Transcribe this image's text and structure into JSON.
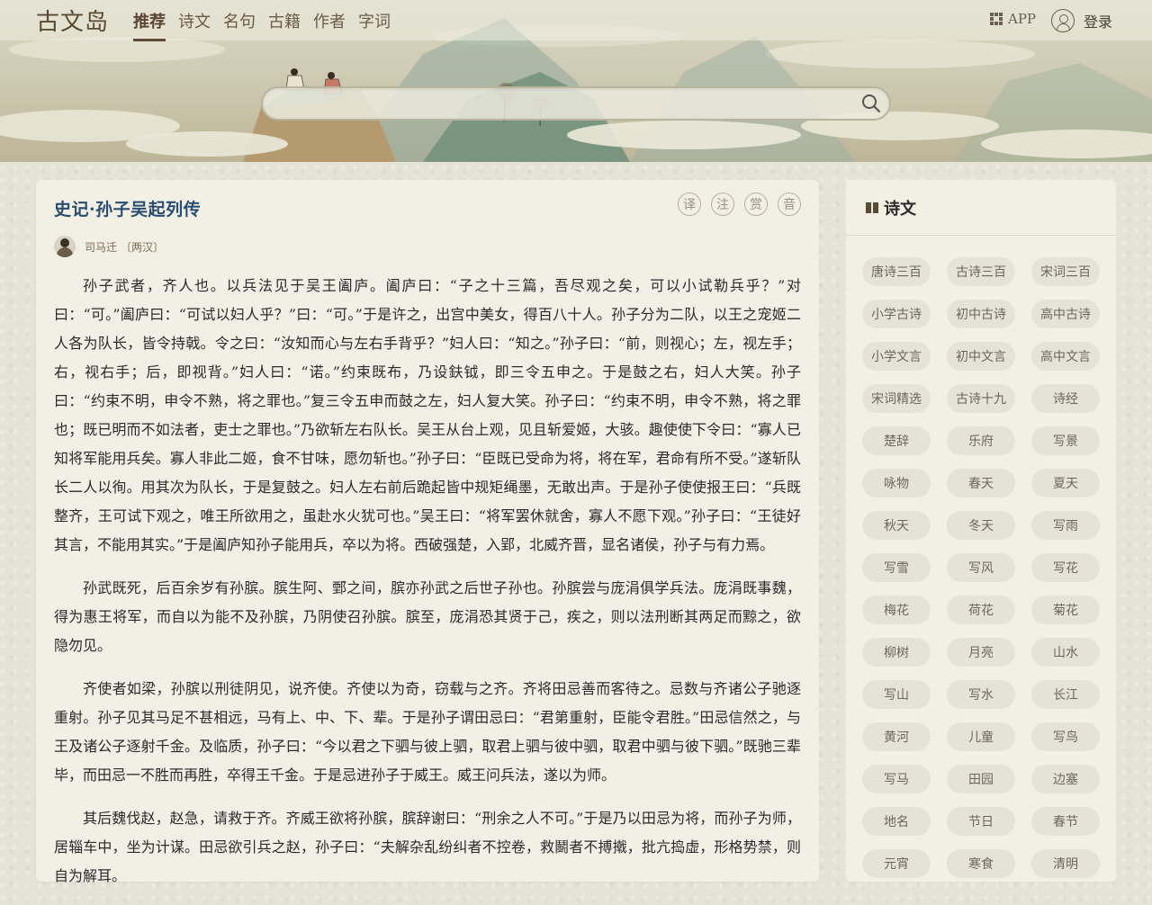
{
  "header": {
    "logo": "古文岛",
    "nav": [
      "推荐",
      "诗文",
      "名句",
      "古籍",
      "作者",
      "字词"
    ],
    "app_label": "APP",
    "login_label": "登录",
    "search_placeholder": ""
  },
  "article": {
    "title": "史记·孙子吴起列传",
    "tools": [
      "译",
      "注",
      "赏",
      "音"
    ],
    "author": "司马迁",
    "dynasty": "〔两汉〕",
    "paragraphs": [
      "孙子武者，齐人也。以兵法见于吴王阖庐。阖庐曰：“子之十三篇，吾尽观之矣，可以小试勒兵乎？”对曰：“可。”阖庐曰：“可试以妇人乎？”曰：“可。”于是许之，出宫中美女，得百八十人。孙子分为二队，以王之宠姬二人各为队长，皆令持戟。令之曰：“汝知而心与左右手背乎？”妇人曰：“知之。”孙子曰：“前，则视心；左，视左手；右，视右手；后，即视背。”妇人曰：“诺。”约束既布，乃设鈇钺，即三令五申之。于是鼓之右，妇人大笑。孙子曰：“约束不明，申令不熟，将之罪也。”复三令五申而鼓之左，妇人复大笑。孙子曰：“约束不明，申令不熟，将之罪也；既已明而不如法者，吏士之罪也。”乃欲斩左右队长。吴王从台上观，见且斩爱姬，大骇。趣使使下令曰：“寡人已知将军能用兵矣。寡人非此二姬，食不甘味，愿勿斩也。”孙子曰：“臣既已受命为将，将在军，君命有所不受。”遂斩队长二人以徇。用其次为队长，于是复鼓之。妇人左右前后跪起皆中规矩绳墨，无敢出声。于是孙子使使报王曰：“兵既整齐，王可试下观之，唯王所欲用之，虽赴水火犹可也。”吴王曰：“将军罢休就舍，寡人不愿下观。”孙子曰：“王徒好其言，不能用其实。”于是阖庐知孙子能用兵，卒以为将。西破强楚，入郢，北威齐晋，显名诸侯，孙子与有力焉。",
      "孙武既死，后百余岁有孙膑。膑生阿、鄄之间，膑亦孙武之后世子孙也。孙膑尝与庞涓俱学兵法。庞涓既事魏，得为惠王将军，而自以为能不及孙膑，乃阴使召孙膑。膑至，庞涓恐其贤于己，疾之，则以法刑断其两足而黥之，欲隐勿见。",
      "齐使者如梁，孙膑以刑徒阴见，说齐使。齐使以为奇，窃载与之齐。齐将田忌善而客待之。忌数与齐诸公子驰逐重射。孙子见其马足不甚相远，马有上、中、下、辈。于是孙子谓田忌曰：“君第重射，臣能令君胜。”田忌信然之，与王及诸公子逐射千金。及临质，孙子曰：“今以君之下驷与彼上驷，取君上驷与彼中驷，取君中驷与彼下驷。”既驰三辈毕，而田忌一不胜而再胜，卒得王千金。于是忌进孙子于威王。威王问兵法，遂以为师。",
      "其后魏伐赵，赵急，请救于齐。齐威王欲将孙膑，膑辞谢曰：“刑余之人不可。”于是乃以田忌为将，而孙子为师，居辎车中，坐为计谋。田忌欲引兵之赵，孙子曰：“夫解杂乱纷纠者不控卷，救鬭者不搏撠，批亢捣虚，形格势禁，则自为解耳。"
    ]
  },
  "sidebar": {
    "title": "诗文",
    "tags": [
      "唐诗三百",
      "古诗三百",
      "宋词三百",
      "小学古诗",
      "初中古诗",
      "高中古诗",
      "小学文言",
      "初中文言",
      "高中文言",
      "宋词精选",
      "古诗十九",
      "诗经",
      "楚辞",
      "乐府",
      "写景",
      "咏物",
      "春天",
      "夏天",
      "秋天",
      "冬天",
      "写雨",
      "写雪",
      "写风",
      "写花",
      "梅花",
      "荷花",
      "菊花",
      "柳树",
      "月亮",
      "山水",
      "写山",
      "写水",
      "长江",
      "黄河",
      "儿童",
      "写鸟",
      "写马",
      "田园",
      "边塞",
      "地名",
      "节日",
      "春节",
      "元宵",
      "寒食",
      "清明"
    ]
  },
  "colors": {
    "title_blue": "#2b4d72",
    "card_bg": "#f2f0e5",
    "page_bg": "#e4e3d6",
    "tag_bg": "#e5e3d8"
  }
}
